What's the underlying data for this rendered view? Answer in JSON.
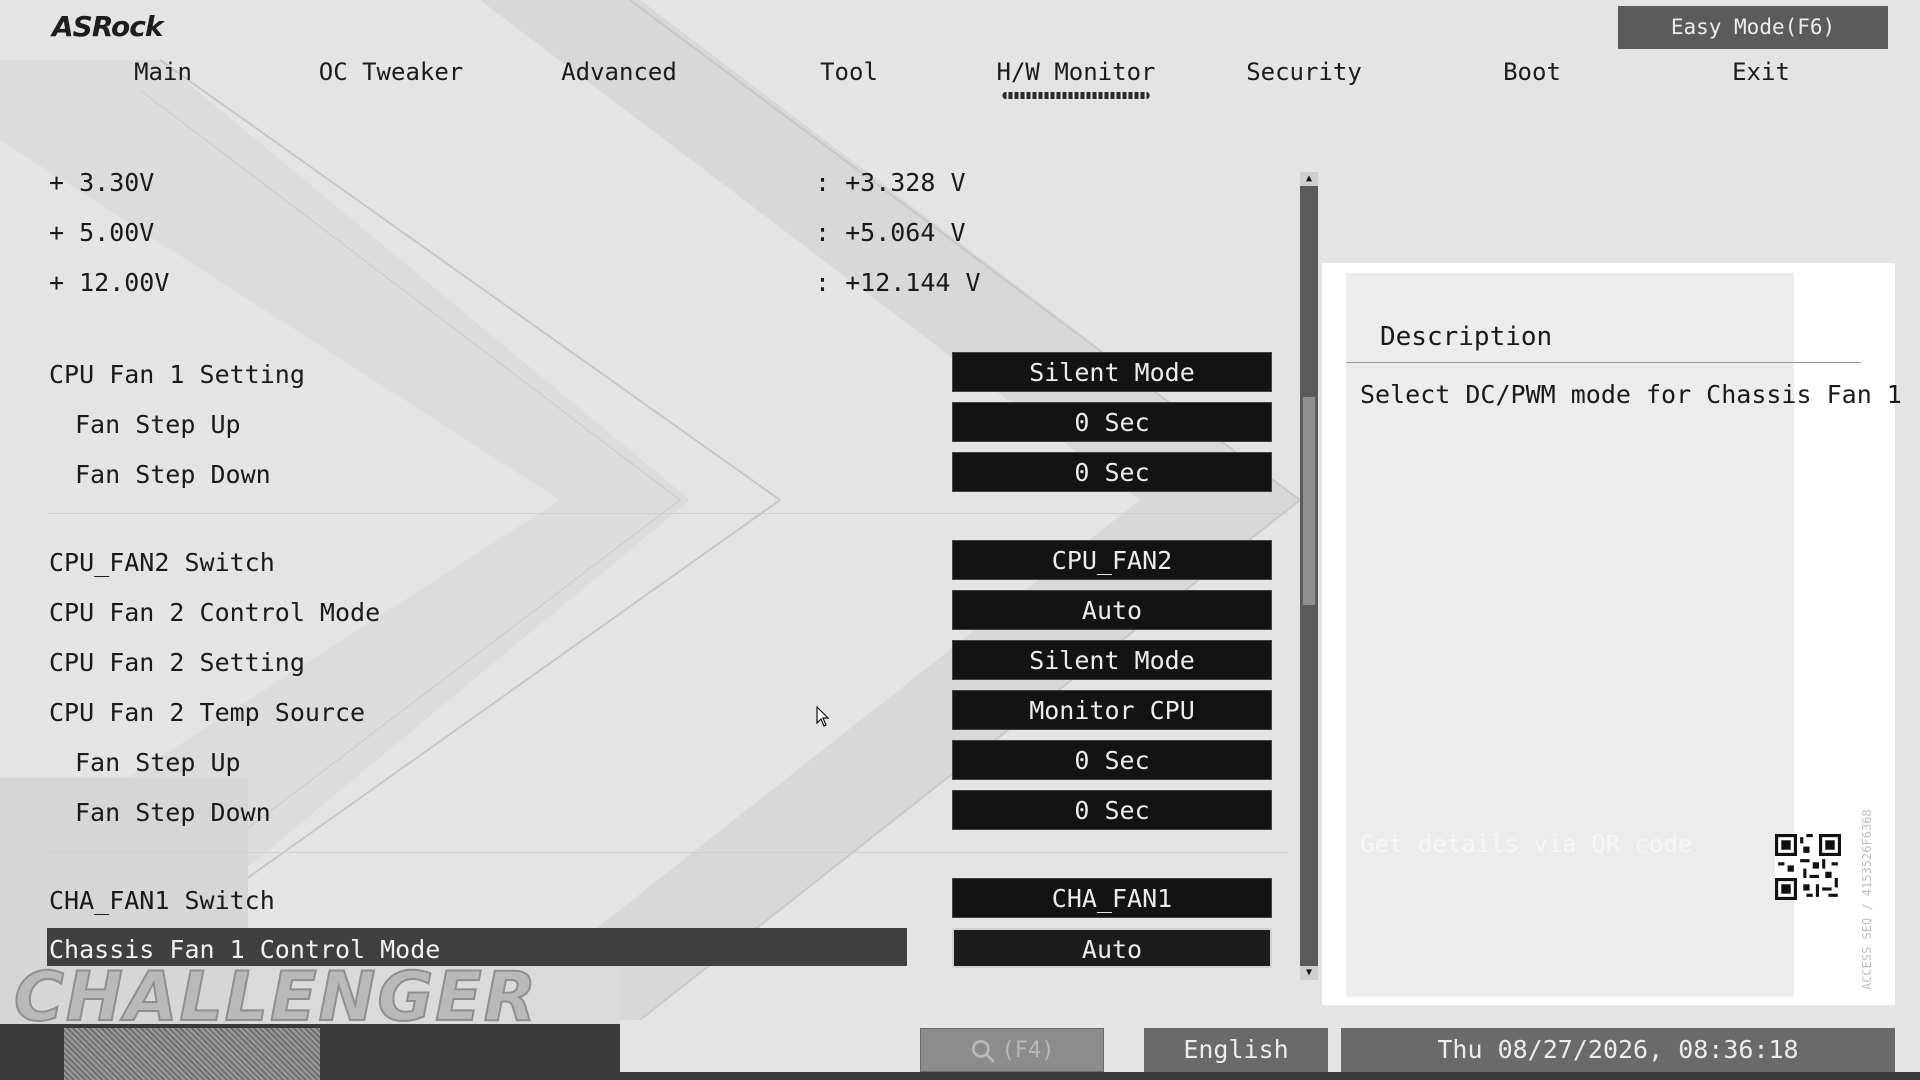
{
  "brand": "ASRock",
  "easy_mode_label": "Easy Mode(F6)",
  "nav": {
    "tabs": [
      {
        "label": "Main"
      },
      {
        "label": "OC Tweaker"
      },
      {
        "label": "Advanced"
      },
      {
        "label": "Tool"
      },
      {
        "label": "H/W Monitor",
        "active": true
      },
      {
        "label": "Security"
      },
      {
        "label": "Boot"
      },
      {
        "label": "Exit"
      }
    ]
  },
  "voltages": [
    {
      "label": "+ 3.30V",
      "value": ": +3.328 V"
    },
    {
      "label": "+ 5.00V",
      "value": ": +5.064 V"
    },
    {
      "label": "+ 12.00V",
      "value": ": +12.144 V"
    }
  ],
  "settings": {
    "cpu_fan1_setting": {
      "label": "CPU Fan 1 Setting",
      "value": "Silent Mode"
    },
    "fan1_step_up": {
      "label": "Fan Step Up",
      "value": "0 Sec"
    },
    "fan1_step_down": {
      "label": "Fan Step Down",
      "value": "0 Sec"
    },
    "cpu_fan2_switch": {
      "label": "CPU_FAN2 Switch",
      "value": "CPU_FAN2"
    },
    "cpu_fan2_control_mode": {
      "label": "CPU Fan 2 Control Mode",
      "value": "Auto"
    },
    "cpu_fan2_setting": {
      "label": "CPU Fan 2 Setting",
      "value": "Silent Mode"
    },
    "cpu_fan2_temp_source": {
      "label": "CPU Fan 2 Temp Source",
      "value": "Monitor CPU"
    },
    "fan2_step_up": {
      "label": "Fan Step Up",
      "value": "0 Sec"
    },
    "fan2_step_down": {
      "label": "Fan Step Down",
      "value": "0 Sec"
    },
    "cha_fan1_switch": {
      "label": "CHA_FAN1 Switch",
      "value": "CHA_FAN1"
    },
    "chassis_fan1_control_mode": {
      "label": "Chassis Fan 1 Control Mode",
      "value": "Auto",
      "selected": true
    }
  },
  "description": {
    "title": "Description",
    "text": "Select DC/PWM mode for Chassis Fan 1",
    "qr_hint": "Get details via QR code",
    "side_code": "ACCESS SEQ / 4153526F6368"
  },
  "watermark": "CHALLENGER",
  "footer": {
    "search_label": "(F4)",
    "language": "English",
    "datetime": "Thu 08/27/2026, 08:36:18"
  },
  "colors": {
    "background": "#e4e4e4",
    "button_dark": "#131313",
    "selected_row": "#404040",
    "panel_gray": "#6a6a6a"
  }
}
